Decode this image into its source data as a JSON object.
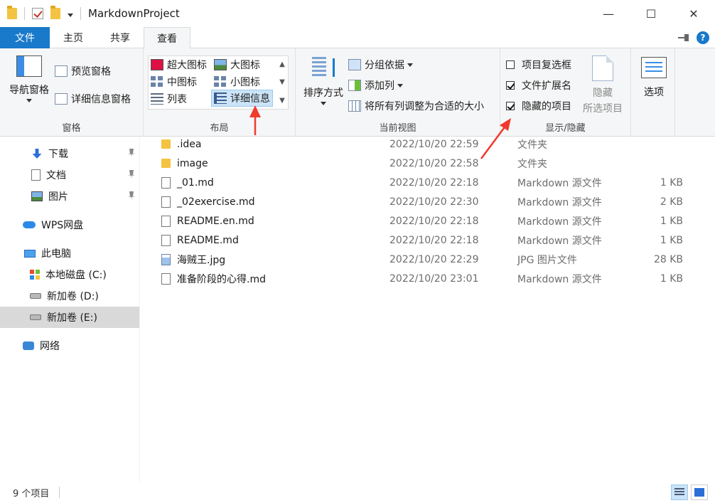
{
  "window": {
    "title": "MarkdownProject",
    "minimize": "—",
    "maximize": "☐",
    "close": "✕"
  },
  "tabs": {
    "file": "文件",
    "home": "主页",
    "share": "共享",
    "view": "查看"
  },
  "ribbon": {
    "pane": {
      "label": "窗格",
      "nav_pane": "导航窗格",
      "preview_pane": "预览窗格",
      "details_pane": "详细信息窗格"
    },
    "layout": {
      "label": "布局",
      "extra_large": "超大图标",
      "large": "大图标",
      "medium": "中图标",
      "small": "小图标",
      "list": "列表",
      "details": "详细信息"
    },
    "current_view": {
      "label": "当前视图",
      "sort_by": "排序方式",
      "group_by": "分组依据",
      "add_column": "添加列",
      "size_columns": "将所有列调整为合适的大小"
    },
    "show_hide": {
      "label": "显示/隐藏",
      "item_checkboxes": "项目复选框",
      "item_checkboxes_checked": false,
      "file_extensions": "文件扩展名",
      "file_extensions_checked": true,
      "hidden_items": "隐藏的项目",
      "hidden_items_checked": true,
      "hide_selected_1": "隐藏",
      "hide_selected_2": "所选项目"
    },
    "options": "选项"
  },
  "nav": {
    "items": [
      {
        "label": "下载",
        "icon": "download-icon",
        "pinned": true
      },
      {
        "label": "文档",
        "icon": "document-icon",
        "pinned": true
      },
      {
        "label": "图片",
        "icon": "picture-icon",
        "pinned": true
      },
      {
        "label": "WPS网盘",
        "icon": "cloud-icon"
      },
      {
        "label": "此电脑",
        "icon": "computer-icon"
      },
      {
        "label": "本地磁盘 (C:)",
        "icon": "windows-drive-icon"
      },
      {
        "label": "新加卷 (D:)",
        "icon": "drive-icon"
      },
      {
        "label": "新加卷 (E:)",
        "icon": "drive-icon",
        "selected": true
      },
      {
        "label": "网络",
        "icon": "network-icon"
      }
    ]
  },
  "files": [
    {
      "name": ".idea",
      "date": "2022/10/20 22:59",
      "type": "文件夹",
      "size": "",
      "icon": "folder"
    },
    {
      "name": "image",
      "date": "2022/10/20 22:58",
      "type": "文件夹",
      "size": "",
      "icon": "folder"
    },
    {
      "name": "_01.md",
      "date": "2022/10/20 22:18",
      "type": "Markdown 源文件",
      "size": "1 KB",
      "icon": "doc"
    },
    {
      "name": "_02exercise.md",
      "date": "2022/10/20 22:30",
      "type": "Markdown 源文件",
      "size": "2 KB",
      "icon": "doc"
    },
    {
      "name": "README.en.md",
      "date": "2022/10/20 22:18",
      "type": "Markdown 源文件",
      "size": "1 KB",
      "icon": "doc"
    },
    {
      "name": "README.md",
      "date": "2022/10/20 22:18",
      "type": "Markdown 源文件",
      "size": "1 KB",
      "icon": "doc"
    },
    {
      "name": "海贼王.jpg",
      "date": "2022/10/20 22:29",
      "type": "JPG 图片文件",
      "size": "28 KB",
      "icon": "img"
    },
    {
      "name": "准备阶段的心得.md",
      "date": "2022/10/20 23:01",
      "type": "Markdown 源文件",
      "size": "1 KB",
      "icon": "doc"
    }
  ],
  "status": {
    "count": "9 个项目"
  },
  "colors": {
    "accent": "#1979ca",
    "annotation": "#f03a2e"
  }
}
